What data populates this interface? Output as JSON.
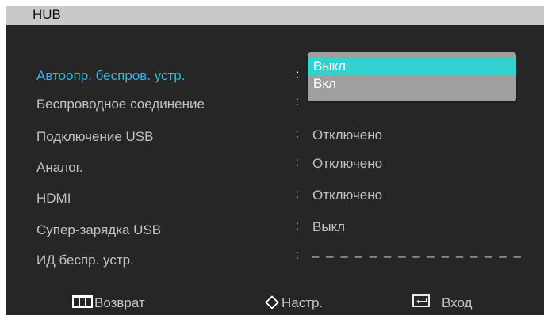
{
  "header": {
    "title": "HUB"
  },
  "menu": {
    "rows": [
      {
        "label": "Автоопр. беспров. устр.",
        "value": ""
      },
      {
        "label": "Беспроводное соединение",
        "value": ""
      },
      {
        "label": "Подключение USB",
        "value": "Отключено"
      },
      {
        "label": "Аналог.",
        "value": "Отключено"
      },
      {
        "label": "HDMI",
        "value": "Отключено"
      },
      {
        "label": "Супер-зарядка USB",
        "value": "Выкл"
      },
      {
        "label": "ИД беспр. устр.",
        "value": ""
      }
    ],
    "separator": ":",
    "id_placeholder": "– – – – – – – – – – – – – – –"
  },
  "dropdown": {
    "options": [
      "Выкл",
      "Вкл"
    ],
    "selected": "Выкл"
  },
  "footer": {
    "back_label": "Возврат",
    "adjust_label": "Настр.",
    "enter_label": "Вход"
  },
  "colors": {
    "background": "#262626",
    "header": "#c9c9c9",
    "active_text": "#31b6df",
    "dropdown_highlight": "#35d0d0",
    "dropdown_background": "#9f9f9f",
    "text": "#c2c2c2"
  }
}
